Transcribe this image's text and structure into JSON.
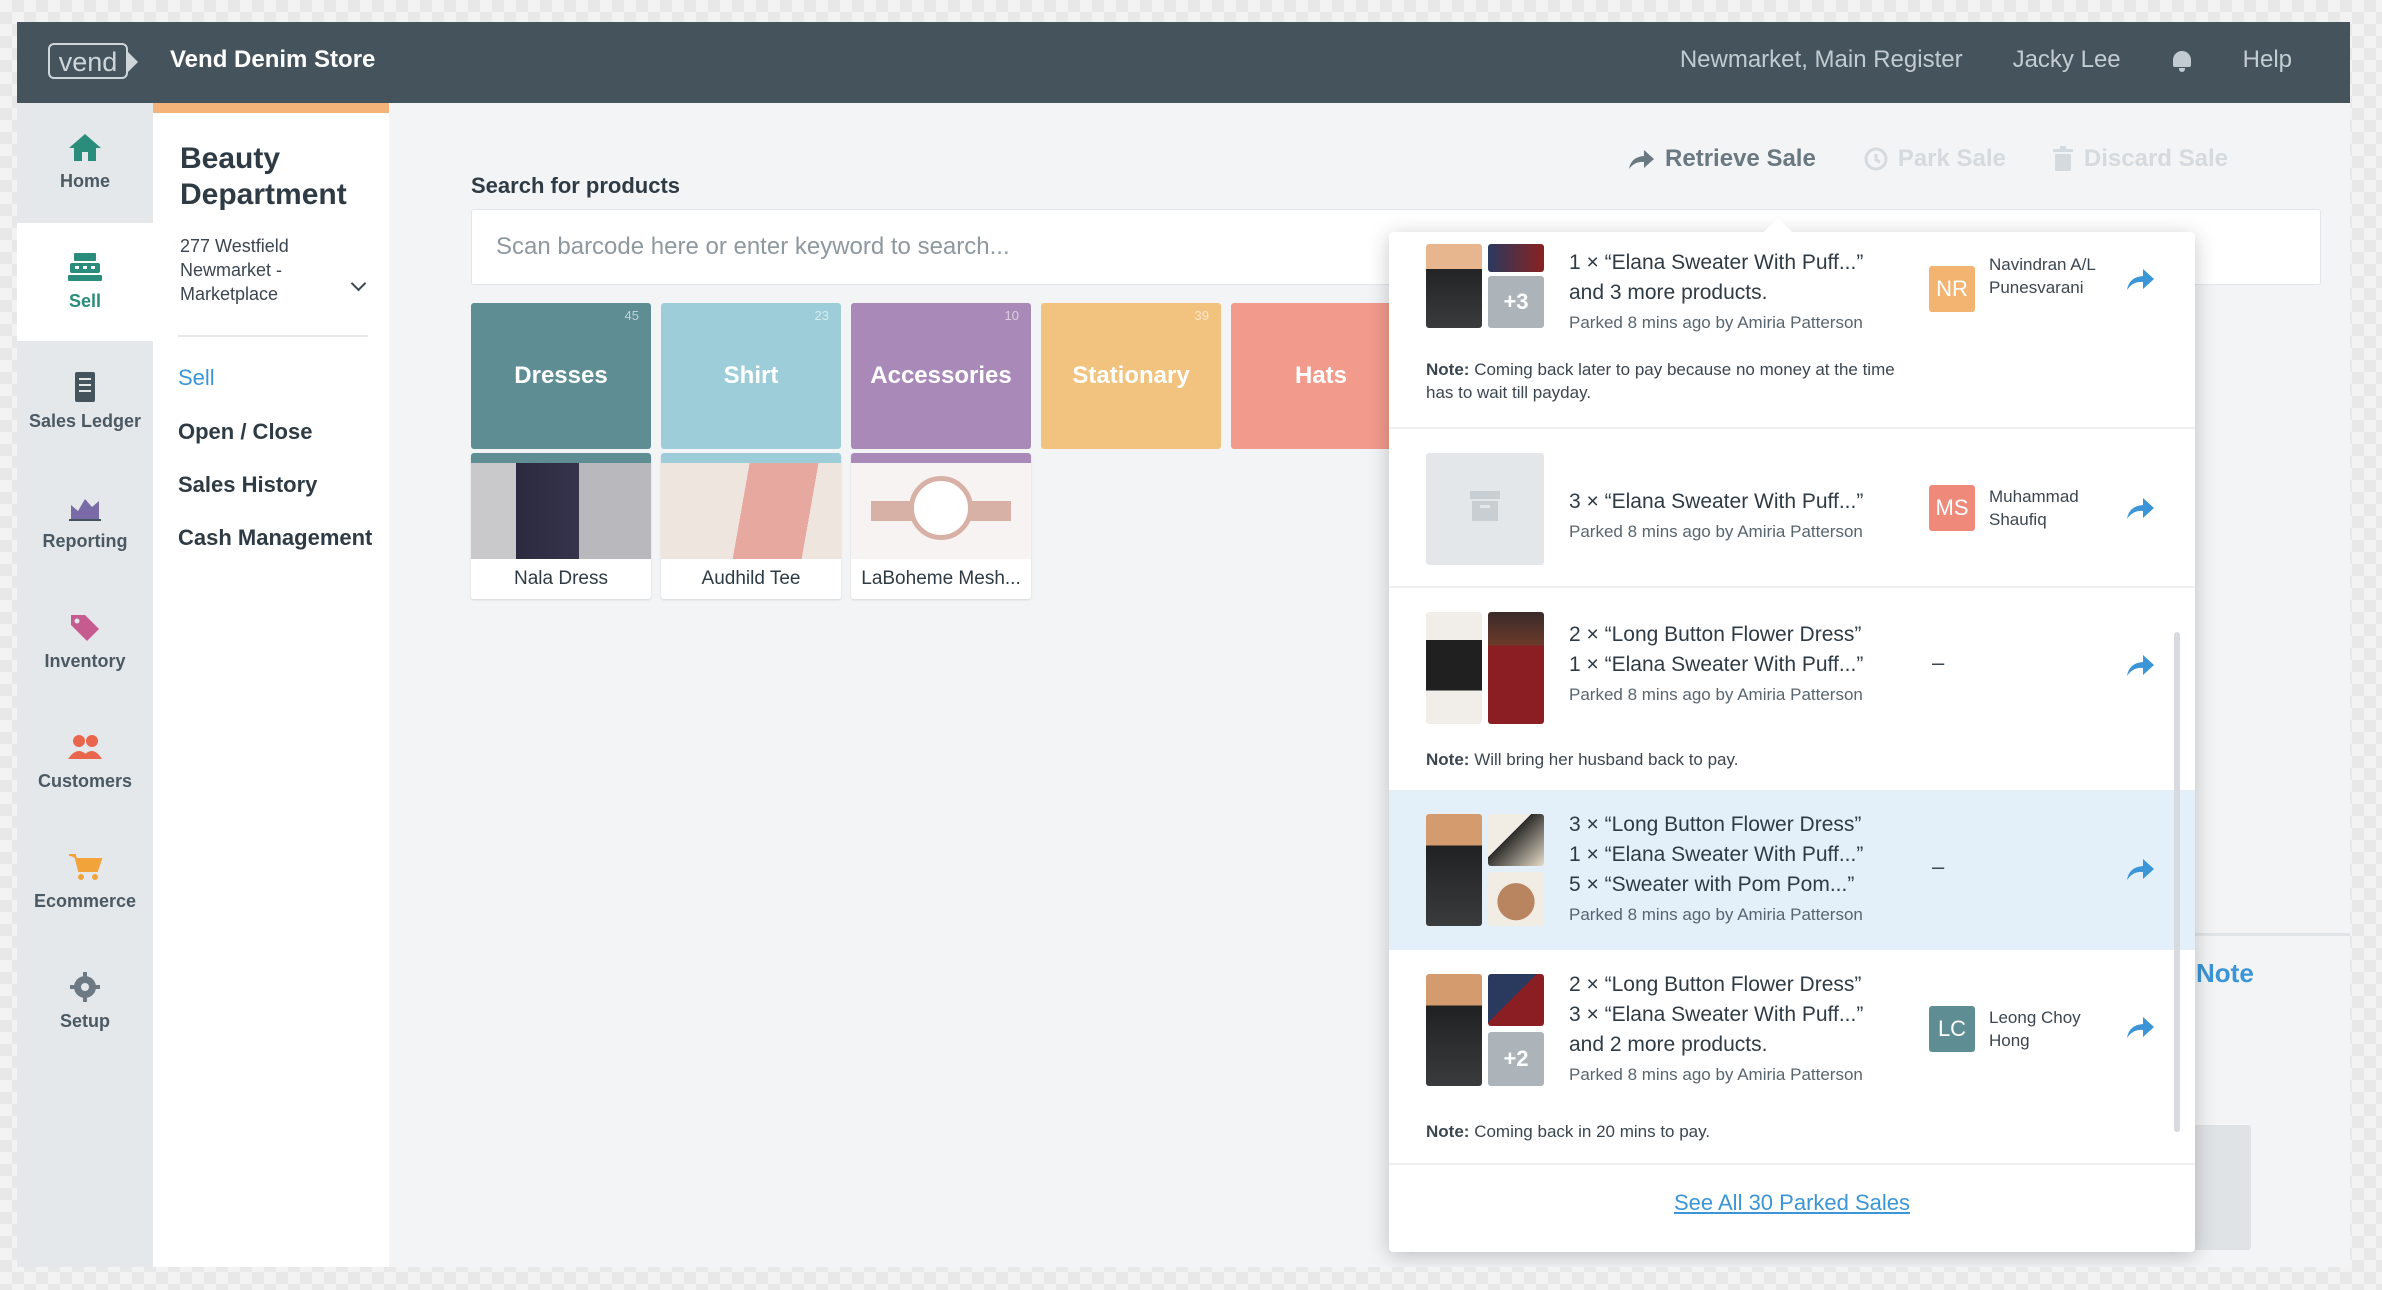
{
  "topbar": {
    "logo_text": "vend",
    "store_name": "Vend Denim Store",
    "register": "Newmarket, Main Register",
    "user": "Jacky Lee",
    "help": "Help"
  },
  "rail": [
    {
      "label": "Home",
      "icon": "home-icon"
    },
    {
      "label": "Sell",
      "icon": "register-icon"
    },
    {
      "label": "Sales Ledger",
      "icon": "ledger-icon"
    },
    {
      "label": "Reporting",
      "icon": "chart-icon"
    },
    {
      "label": "Inventory",
      "icon": "tag-icon"
    },
    {
      "label": "Customers",
      "icon": "people-icon"
    },
    {
      "label": "Ecommerce",
      "icon": "cart-icon"
    },
    {
      "label": "Setup",
      "icon": "gear-icon"
    }
  ],
  "outlet": {
    "name": "Beauty Department",
    "address": "277 Westfield Newmarket - Marketplace"
  },
  "subnav": [
    "Sell",
    "Open / Close",
    "Sales History",
    "Cash Management"
  ],
  "search": {
    "label": "Search for products",
    "placeholder": "Scan barcode here or enter keyword to search..."
  },
  "actions": {
    "retrieve": "Retrieve Sale",
    "park": "Park Sale",
    "discard": "Discard Sale"
  },
  "categories": [
    {
      "name": "Dresses",
      "count": "45",
      "color": "#5f8d94"
    },
    {
      "name": "Shirt",
      "count": "23",
      "color": "#9ccdd8"
    },
    {
      "name": "Accessories",
      "count": "10",
      "color": "#a889b8"
    },
    {
      "name": "Stationary",
      "count": "39",
      "color": "#f2c27f"
    },
    {
      "name": "Hats",
      "count": "",
      "color": "#f29a8c"
    }
  ],
  "products": [
    {
      "name": "Nala Dress",
      "stripe": "#5f8d94"
    },
    {
      "name": "Audhild Tee",
      "stripe": "#9ccdd8"
    },
    {
      "name": "LaBoheme Mesh...",
      "stripe": "#a889b8"
    }
  ],
  "parked": [
    {
      "lines": [
        "1 × “Elana Sweater With Puff...”",
        "and 3 more products."
      ],
      "meta": "Parked 8 mins ago by Amiria Patterson",
      "avatar": "NR",
      "avatar_color": "#f3b471",
      "customer": "Navindran A/L Punesvarani",
      "note_label": "Note:",
      "note": "Coming back later to pay because no money at the time has to wait till payday.",
      "plus": "+3"
    },
    {
      "lines": [
        "3 × “Elana Sweater With Puff...”"
      ],
      "meta": "Parked 8 mins ago by Amiria Patterson",
      "avatar": "MS",
      "avatar_color": "#ef8a7b",
      "customer": "Muhammad Shaufiq"
    },
    {
      "lines": [
        "2 × “Long Button Flower Dress”",
        "1 × “Elana Sweater With Puff...”"
      ],
      "meta": "Parked 8 mins ago by Amiria Patterson",
      "customer_dash": "–",
      "note_label": "Note:",
      "note": "Will bring her husband back to pay."
    },
    {
      "lines": [
        "3 × “Long Button Flower Dress”",
        "1 × “Elana Sweater With Puff...”",
        "5 × “Sweater with Pom Pom...”"
      ],
      "meta": "Parked 8 mins ago by Amiria Patterson",
      "customer_dash": "–"
    },
    {
      "lines": [
        "2 × “Long Button Flower Dress”",
        "3 × “Elana Sweater With Puff...”",
        "and 2 more products."
      ],
      "meta": "Parked 8 mins ago by Amiria Patterson",
      "avatar": "LC",
      "avatar_color": "#5f8d94",
      "customer": "Leong Choy Hong",
      "note_label": "Note:",
      "note": "Coming back in 20 mins to pay.",
      "plus": "+2"
    }
  ],
  "see_all": "See All 30 Parked Sales",
  "note_link": "Note",
  "colors": {
    "topbar": "#45535d",
    "accent": "#3b95d6",
    "sell_green": "#2a8c7a"
  }
}
